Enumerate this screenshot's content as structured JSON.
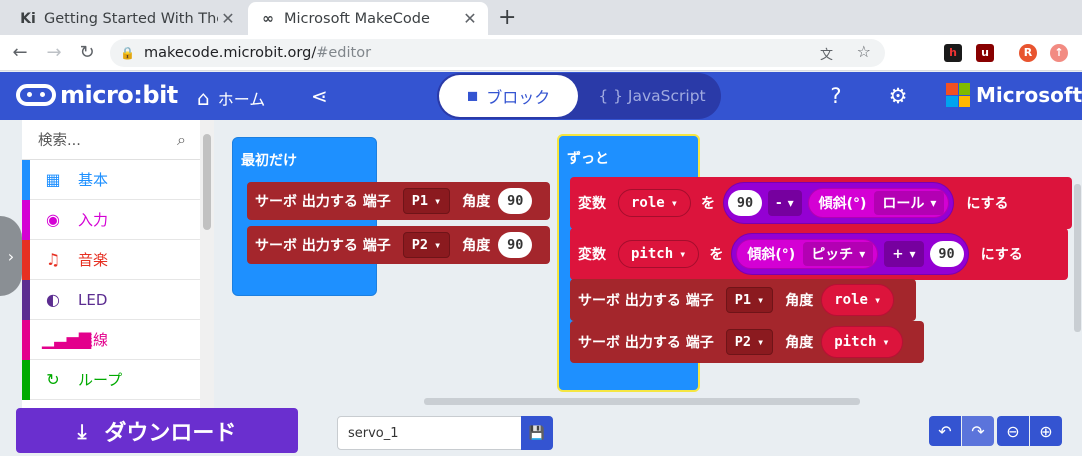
{
  "browser": {
    "tabs": [
      {
        "favicon": "Ki",
        "title": "Getting Started With The",
        "close": "✕"
      },
      {
        "favicon": "∞",
        "title": "Microsoft MakeCode",
        "close": "✕"
      }
    ],
    "new_tab": "+",
    "url_host": "makecode.microbit.org/",
    "url_path": "#editor",
    "profile_initial": "R"
  },
  "header": {
    "logo_text": "micro:bit",
    "home_label": "ホーム",
    "blocks_label": "ブロック",
    "js_label": "{ }  JavaScript",
    "ms_label": "Microsoft",
    "ms_colors": [
      "#f25022",
      "#7fba00",
      "#00a4ef",
      "#ffb900"
    ]
  },
  "toolbox": {
    "search_placeholder": "検索...",
    "categories": [
      {
        "label": "基本",
        "color": "#1e90ff",
        "icon": "grid-icon"
      },
      {
        "label": "入力",
        "color": "#d400d4",
        "icon": "input-icon"
      },
      {
        "label": "音楽",
        "color": "#e63022",
        "icon": "headphones-icon"
      },
      {
        "label": "LED",
        "color": "#5c2d91",
        "icon": "toggle-icon"
      },
      {
        "label": "無線",
        "color": "#e3008c",
        "icon": "signal-icon"
      },
      {
        "label": "ループ",
        "color": "#00aa00",
        "icon": "loop-icon"
      }
    ]
  },
  "workspace": {
    "on_start": {
      "label": "最初だけ",
      "blocks": [
        {
          "text": "サーボ 出力する 端子",
          "pin": "P1",
          "angle_label": "角度",
          "angle": "90"
        },
        {
          "text": "サーボ 出力する 端子",
          "pin": "P2",
          "angle_label": "角度",
          "angle": "90"
        }
      ]
    },
    "forever": {
      "label": "ずっと",
      "set_role": {
        "prefix": "変数",
        "var": "role",
        "to": "を",
        "left": "90",
        "op": "-",
        "tilt": "傾斜(°)",
        "axis": "ロール",
        "suffix": "にする"
      },
      "set_pitch": {
        "prefix": "変数",
        "var": "pitch",
        "to": "を",
        "tilt": "傾斜(°)",
        "axis": "ピッチ",
        "op": "+",
        "right": "90",
        "suffix": "にする"
      },
      "servo1": {
        "text": "サーボ 出力する 端子",
        "pin": "P1",
        "angle_label": "角度",
        "value": "role"
      },
      "servo2": {
        "text": "サーボ 出力する 端子",
        "pin": "P2",
        "angle_label": "角度",
        "value": "pitch"
      }
    }
  },
  "bottom": {
    "download_label": "ダウンロード",
    "project_name": "servo_1"
  }
}
